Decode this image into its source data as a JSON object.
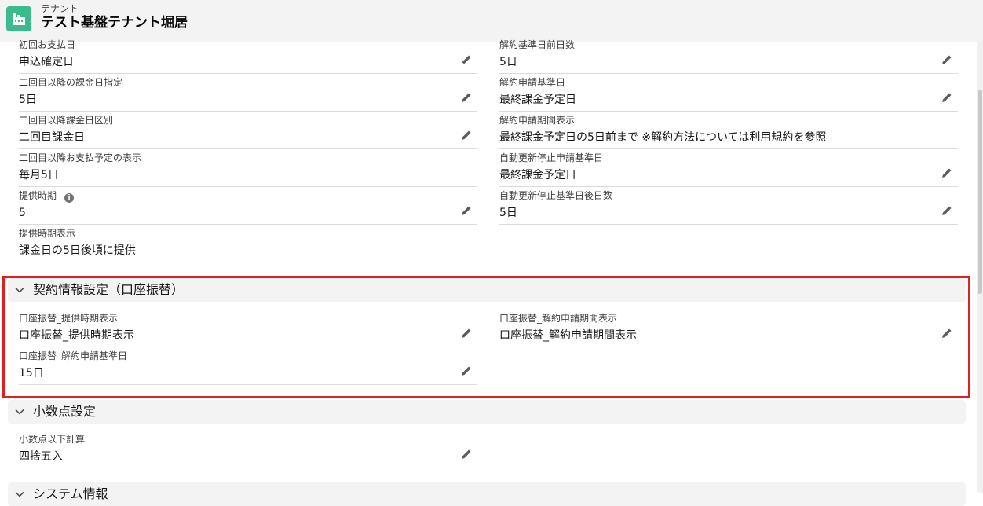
{
  "header": {
    "object_type": "テナント",
    "record_name": "テスト基盤テナント堀居",
    "icon": "building-icon",
    "icon_color": "#3bba8c"
  },
  "fields_top_left": [
    {
      "label": "初回お支払日",
      "value": "申込確定日",
      "editable": true
    },
    {
      "label": "二回目以降の課金日指定",
      "value": "5日",
      "editable": true
    },
    {
      "label": "二回目以降課金日区別",
      "value": "二回目課金日",
      "editable": true
    },
    {
      "label": "二回目以降お支払予定の表示",
      "value": "毎月5日",
      "editable": false
    },
    {
      "label": "提供時期",
      "value": "5",
      "editable": true,
      "info": true
    },
    {
      "label": "提供時期表示",
      "value": "課金日の5日後頃に提供",
      "editable": false
    }
  ],
  "fields_top_right": [
    {
      "label": "解約基準日前日数",
      "value": "5日",
      "editable": true
    },
    {
      "label": "解約申請基準日",
      "value": "最終課金予定日",
      "editable": true
    },
    {
      "label": "解約申請期間表示",
      "value": "最終課金予定日の5日前まで ※解約方法については利用規約を参照",
      "editable": false
    },
    {
      "label": "自動更新停止申請基準日",
      "value": "最終課金予定日",
      "editable": true
    },
    {
      "label": "自動更新停止基準日後日数",
      "value": "5日",
      "editable": true
    }
  ],
  "section_contract": {
    "title": "契約情報設定（口座振替）",
    "fields_left": [
      {
        "label": "口座振替_提供時期表示",
        "value": "口座振替_提供時期表示",
        "editable": true
      },
      {
        "label": "口座振替_解約申請基準日",
        "value": "15日",
        "editable": true
      }
    ],
    "fields_right": [
      {
        "label": "口座振替_解約申請期間表示",
        "value": "口座振替_解約申請期間表示",
        "editable": true
      }
    ]
  },
  "section_decimal": {
    "title": "小数点設定",
    "fields_left": [
      {
        "label": "小数点以下計算",
        "value": "四捨五入",
        "editable": true
      }
    ]
  },
  "section_system": {
    "title": "システム情報"
  },
  "colors": {
    "highlight": "#e02020",
    "section_bg": "#f3f3f3"
  }
}
